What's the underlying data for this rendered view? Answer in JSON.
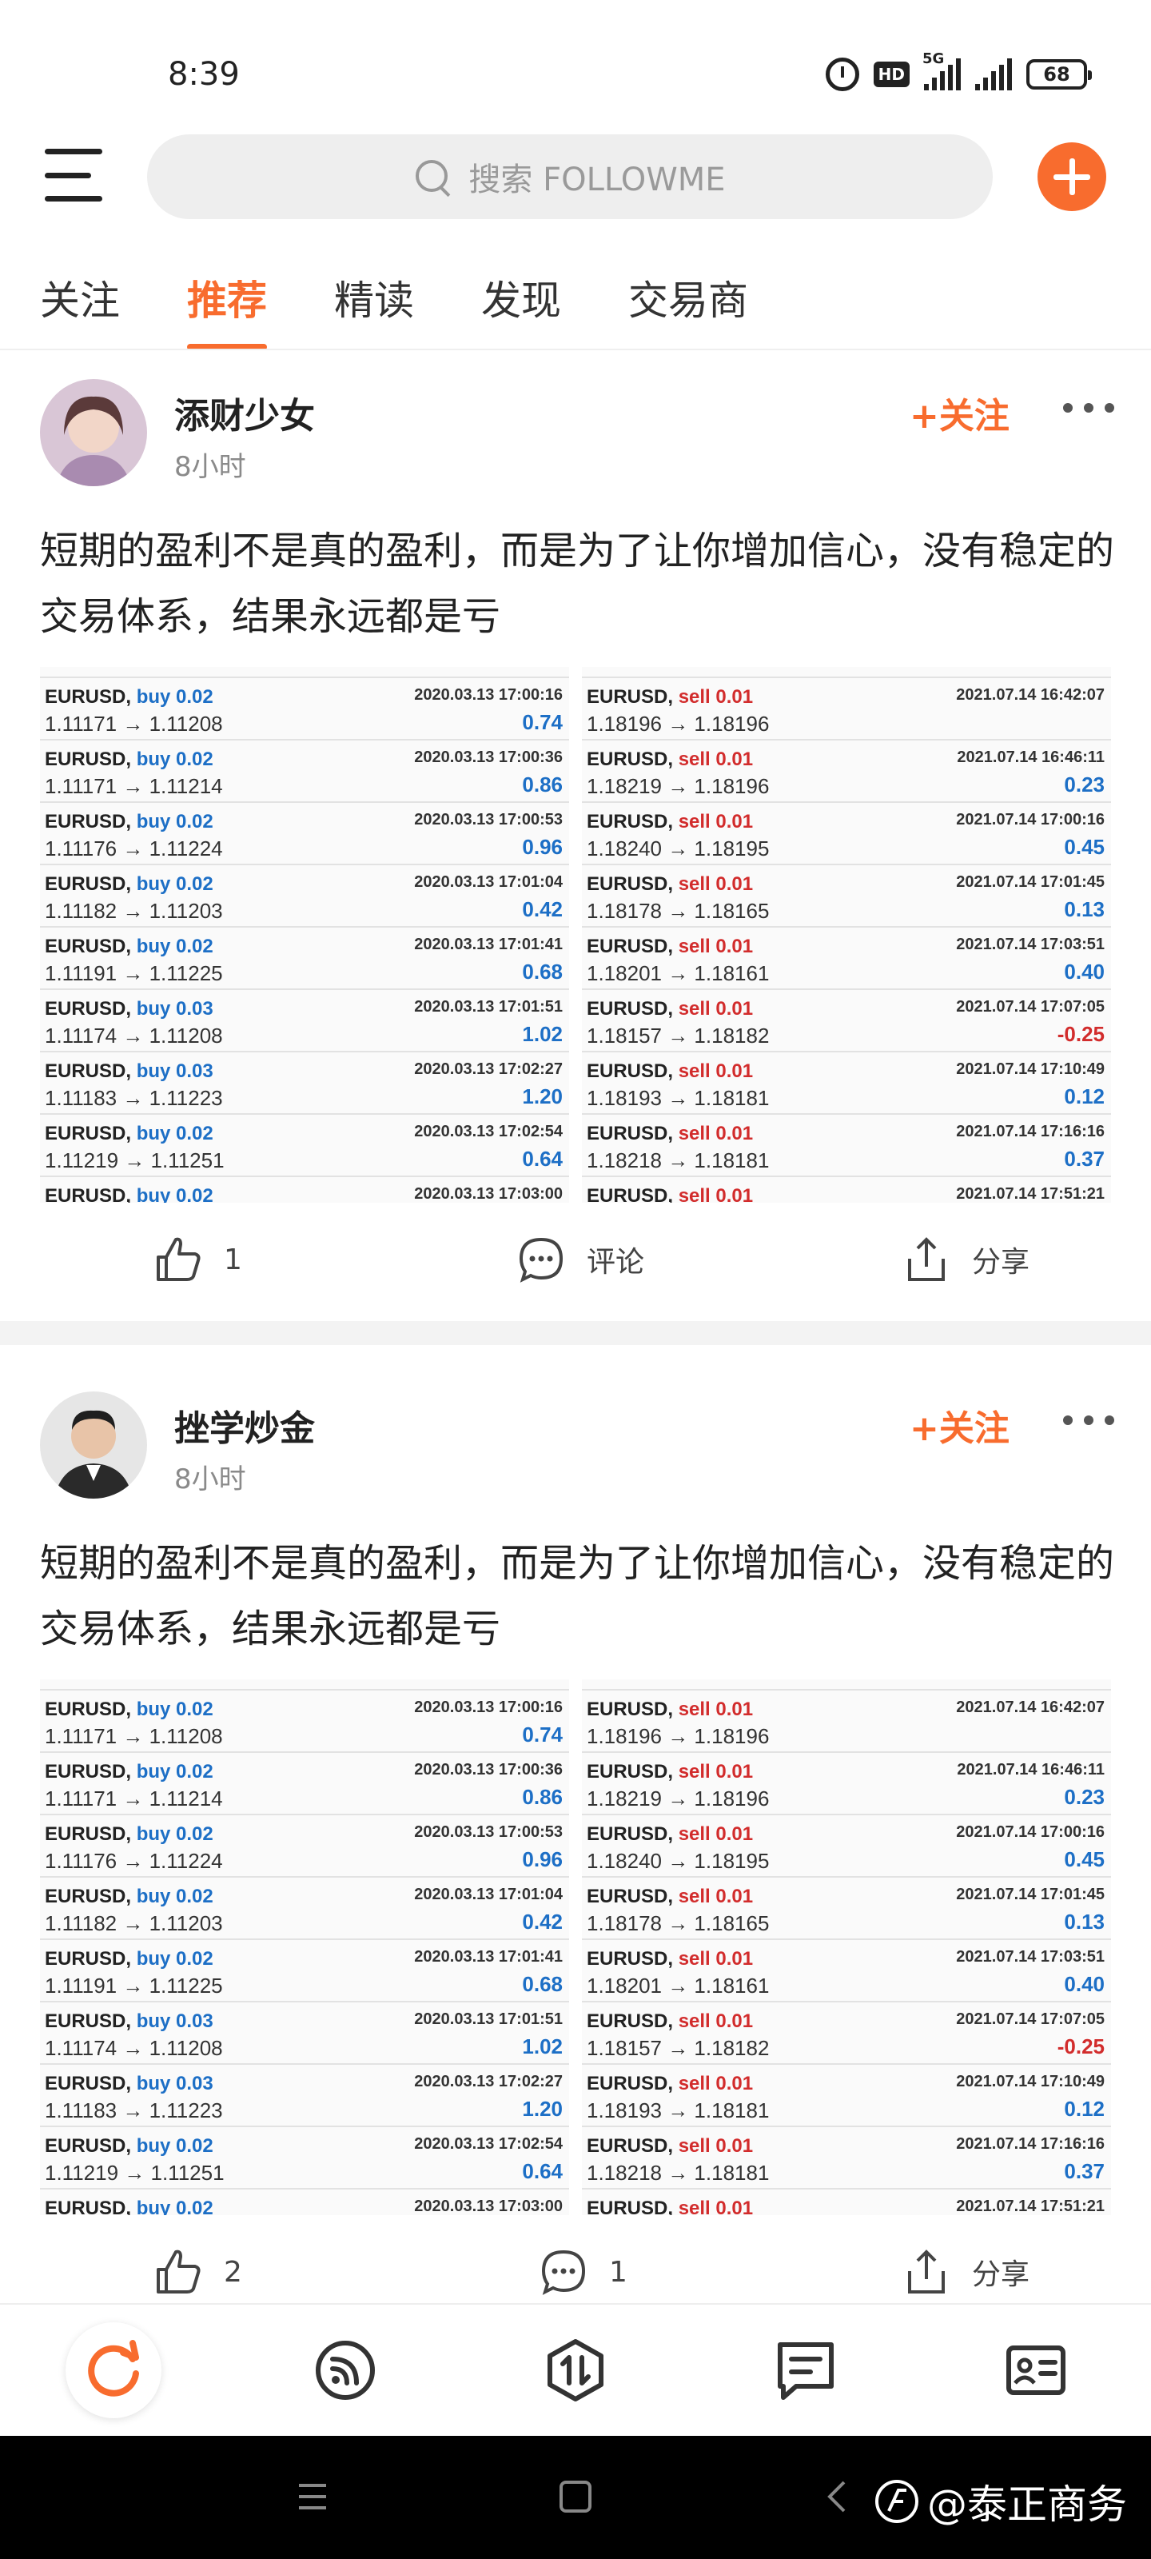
{
  "status_bar": {
    "time": "8:39",
    "network": "5G",
    "hd": "HD",
    "battery": "68"
  },
  "header": {
    "search_placeholder": "搜索 FOLLOWME"
  },
  "tabs": [
    {
      "label": "关注",
      "active": false
    },
    {
      "label": "推荐",
      "active": true
    },
    {
      "label": "精读",
      "active": false
    },
    {
      "label": "发现",
      "active": false
    },
    {
      "label": "交易商",
      "active": false
    }
  ],
  "posts": [
    {
      "author": "添财少女",
      "time_ago": "8小时",
      "follow_label": "+关注",
      "text": "短期的盈利不是真的盈利，而是为了让你增加信心，没有稳定的交易体系，结果永远都是亏",
      "likes": "1",
      "comments": "评论",
      "share": "分享"
    },
    {
      "author": "挫学炒金",
      "time_ago": "8小时",
      "follow_label": "+关注",
      "text": "短期的盈利不是真的盈利，而是为了让你增加信心，没有稳定的交易体系，结果永远都是亏",
      "likes": "2",
      "comments": "1",
      "share": "分享"
    }
  ],
  "trades_left": [
    {
      "symbol": "EURUSD,",
      "side": "buy 0.02",
      "date": "2020.03.13 17:00:16",
      "price": "1.11171 → 1.11208",
      "profit": "0.74"
    },
    {
      "symbol": "EURUSD,",
      "side": "buy 0.02",
      "date": "2020.03.13 17:00:36",
      "price": "1.11171 → 1.11214",
      "profit": "0.86"
    },
    {
      "symbol": "EURUSD,",
      "side": "buy 0.02",
      "date": "2020.03.13 17:00:53",
      "price": "1.11176 → 1.11224",
      "profit": "0.96"
    },
    {
      "symbol": "EURUSD,",
      "side": "buy 0.02",
      "date": "2020.03.13 17:01:04",
      "price": "1.11182 → 1.11203",
      "profit": "0.42"
    },
    {
      "symbol": "EURUSD,",
      "side": "buy 0.02",
      "date": "2020.03.13 17:01:41",
      "price": "1.11191 → 1.11225",
      "profit": "0.68"
    },
    {
      "symbol": "EURUSD,",
      "side": "buy 0.03",
      "date": "2020.03.13 17:01:51",
      "price": "1.11174 → 1.11208",
      "profit": "1.02"
    },
    {
      "symbol": "EURUSD,",
      "side": "buy 0.03",
      "date": "2020.03.13 17:02:27",
      "price": "1.11183 → 1.11223",
      "profit": "1.20"
    },
    {
      "symbol": "EURUSD,",
      "side": "buy 0.02",
      "date": "2020.03.13 17:02:54",
      "price": "1.11219 → 1.11251",
      "profit": "0.64"
    },
    {
      "symbol": "EURUSD,",
      "side": "buy 0.02",
      "date": "2020.03.13 17:03:00",
      "price": "",
      "profit": ""
    }
  ],
  "trades_right": [
    {
      "symbol": "EURUSD,",
      "side": "sell 0.01",
      "date": "2021.07.14 16:42:07",
      "price": "1.18196 → 1.18196",
      "profit": ""
    },
    {
      "symbol": "EURUSD,",
      "side": "sell 0.01",
      "date": "2021.07.14 16:46:11",
      "price": "1.18219 → 1.18196",
      "profit": "0.23"
    },
    {
      "symbol": "EURUSD,",
      "side": "sell 0.01",
      "date": "2021.07.14 17:00:16",
      "price": "1.18240 → 1.18195",
      "profit": "0.45"
    },
    {
      "symbol": "EURUSD,",
      "side": "sell 0.01",
      "date": "2021.07.14 17:01:45",
      "price": "1.18178 → 1.18165",
      "profit": "0.13"
    },
    {
      "symbol": "EURUSD,",
      "side": "sell 0.01",
      "date": "2021.07.14 17:03:51",
      "price": "1.18201 → 1.18161",
      "profit": "0.40"
    },
    {
      "symbol": "EURUSD,",
      "side": "sell 0.01",
      "date": "2021.07.14 17:07:05",
      "price": "1.18157 → 1.18182",
      "profit": "-0.25"
    },
    {
      "symbol": "EURUSD,",
      "side": "sell 0.01",
      "date": "2021.07.14 17:10:49",
      "price": "1.18193 → 1.18181",
      "profit": "0.12"
    },
    {
      "symbol": "EURUSD,",
      "side": "sell 0.01",
      "date": "2021.07.14 17:16:16",
      "price": "1.18218 → 1.18181",
      "profit": "0.37"
    },
    {
      "symbol": "EURUSD,",
      "side": "sell 0.01",
      "date": "2021.07.14 17:51:21",
      "price": "",
      "profit": ""
    }
  ],
  "bottom_nav": [
    "refresh-icon",
    "feed-icon",
    "trade-icon",
    "notes-icon",
    "profile-card-icon"
  ],
  "watermark": "@泰正商务",
  "colors": {
    "accent": "#f86c2e",
    "buy": "#1d6fc6",
    "sell": "#d22c2c"
  }
}
